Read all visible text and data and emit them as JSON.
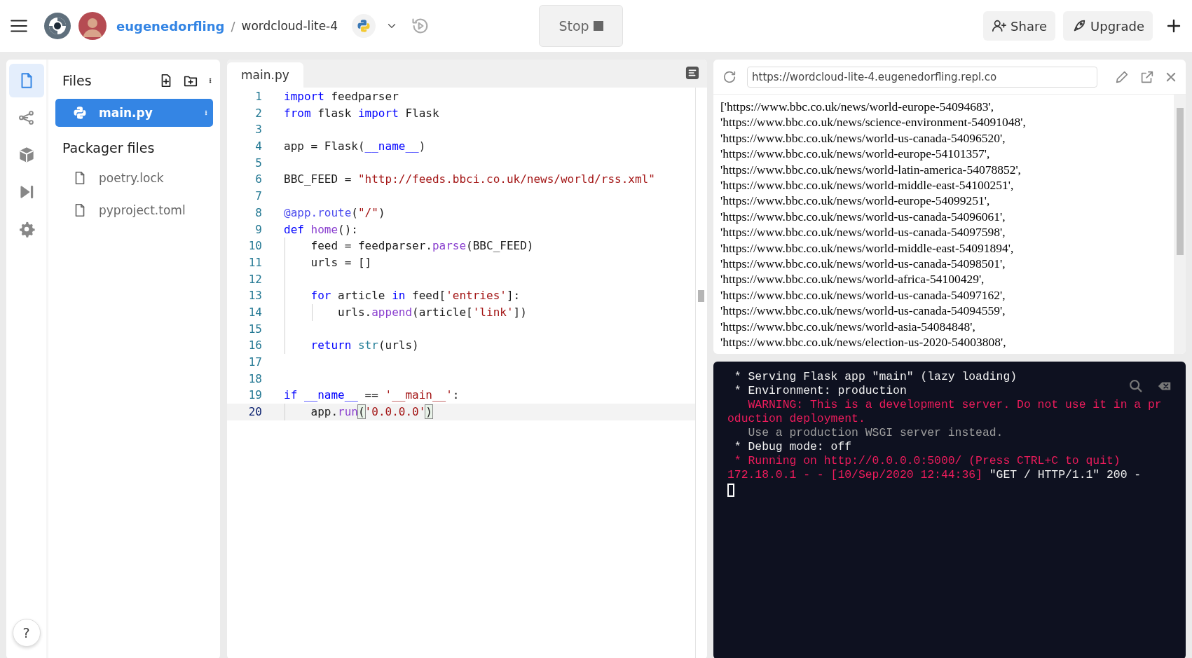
{
  "header": {
    "user": "eugenedorfling",
    "separator": "/",
    "repl_name": "wordcloud-lite-4",
    "stop_label": "Stop",
    "share_label": "Share",
    "upgrade_label": "Upgrade"
  },
  "sidebar_tools": [
    {
      "selected": true
    },
    {
      "selected": false
    },
    {
      "selected": false
    },
    {
      "selected": false
    },
    {
      "selected": false
    }
  ],
  "help_label": "?",
  "files_panel": {
    "title": "Files",
    "files": [
      {
        "name": "main.py",
        "selected": true
      }
    ],
    "packager_title": "Packager files",
    "packager_files": [
      {
        "name": "poetry.lock",
        "selected": false
      },
      {
        "name": "pyproject.toml",
        "selected": false
      }
    ]
  },
  "editor": {
    "tabs": [
      {
        "label": "main.py",
        "selected": true
      }
    ],
    "lines": [
      {
        "number": "1",
        "current": false,
        "tokens": [
          {
            "text": "import",
            "kind": "keyword"
          },
          {
            "text": " feedparser",
            "kind": "plain"
          }
        ]
      },
      {
        "number": "2",
        "current": false,
        "tokens": [
          {
            "text": "from",
            "kind": "keyword"
          },
          {
            "text": " flask ",
            "kind": "plain"
          },
          {
            "text": "import",
            "kind": "keyword"
          },
          {
            "text": " Flask",
            "kind": "plain"
          }
        ]
      },
      {
        "number": "3",
        "current": false
      },
      {
        "number": "4",
        "current": false,
        "tokens": [
          {
            "text": "app = Flask(",
            "kind": "plain"
          },
          {
            "text": "__name__",
            "kind": "keyword"
          },
          {
            "text": ")",
            "kind": "plain"
          }
        ]
      },
      {
        "number": "5",
        "current": false
      },
      {
        "number": "6",
        "current": false,
        "tokens": [
          {
            "text": "BBC_FEED = ",
            "kind": "plain"
          },
          {
            "text": "\"http://feeds.bbci.co.uk/news/world/rss.xml\"",
            "kind": "string"
          }
        ]
      },
      {
        "number": "7",
        "current": false
      },
      {
        "number": "8",
        "current": false,
        "tokens": [
          {
            "text": "@app.route",
            "kind": "decorator"
          },
          {
            "text": "(",
            "kind": "plain"
          },
          {
            "text": "\"/\"",
            "kind": "string"
          },
          {
            "text": ")",
            "kind": "plain"
          }
        ]
      },
      {
        "number": "9",
        "current": false,
        "tokens": [
          {
            "text": "def ",
            "kind": "keyword"
          },
          {
            "text": "home",
            "kind": "function"
          },
          {
            "text": "():",
            "kind": "plain"
          }
        ]
      },
      {
        "number": "10",
        "current": false,
        "tokens": [
          {
            "text": "    feed = feedparser.",
            "kind": "plain"
          },
          {
            "text": "parse",
            "kind": "function"
          },
          {
            "text": "(BBC_FEED)",
            "kind": "plain"
          }
        ]
      },
      {
        "number": "11",
        "current": false,
        "tokens": [
          {
            "text": "    urls = []",
            "kind": "plain"
          }
        ]
      },
      {
        "number": "12",
        "current": false
      },
      {
        "number": "13",
        "current": false,
        "tokens": [
          {
            "text": "    for",
            "kind": "keyword"
          },
          {
            "text": " article ",
            "kind": "plain"
          },
          {
            "text": "in",
            "kind": "keyword"
          },
          {
            "text": " feed[",
            "kind": "plain"
          },
          {
            "text": "'entries'",
            "kind": "string"
          },
          {
            "text": "]:",
            "kind": "plain"
          }
        ]
      },
      {
        "number": "14",
        "current": false,
        "tokens": [
          {
            "text": "        urls.",
            "kind": "plain"
          },
          {
            "text": "append",
            "kind": "function"
          },
          {
            "text": "(article[",
            "kind": "plain"
          },
          {
            "text": "'link'",
            "kind": "string"
          },
          {
            "text": "])",
            "kind": "plain"
          }
        ]
      },
      {
        "number": "15",
        "current": false
      },
      {
        "number": "16",
        "current": false,
        "tokens": [
          {
            "text": "    return ",
            "kind": "keyword"
          },
          {
            "text": "str",
            "kind": "builtin"
          },
          {
            "text": "(urls)",
            "kind": "plain"
          }
        ]
      },
      {
        "number": "17",
        "current": false
      },
      {
        "number": "18",
        "current": false
      },
      {
        "number": "19",
        "current": false,
        "tokens": [
          {
            "text": "if __name__",
            "kind": "keyword"
          },
          {
            "text": " == ",
            "kind": "plain"
          },
          {
            "text": "'__main__'",
            "kind": "string"
          },
          {
            "text": ":",
            "kind": "plain"
          }
        ]
      },
      {
        "number": "20",
        "current": true,
        "tokens": [
          {
            "text": "    app.",
            "kind": "plain"
          },
          {
            "text": "run",
            "kind": "function"
          },
          {
            "text": "(",
            "kind": "match"
          },
          {
            "text": "'0.0.0.0'",
            "kind": "string"
          },
          {
            "text": ")",
            "kind": "match"
          }
        ]
      }
    ]
  },
  "webview": {
    "url": "https://wordcloud-lite-4.eugenedorfling.repl.co",
    "output_lines": [
      "['https://www.bbc.co.uk/news/world-europe-54094683',",
      "'https://www.bbc.co.uk/news/science-environment-54091048',",
      "'https://www.bbc.co.uk/news/world-us-canada-54096520',",
      "'https://www.bbc.co.uk/news/world-europe-54101357',",
      "'https://www.bbc.co.uk/news/world-latin-america-54078852',",
      "'https://www.bbc.co.uk/news/world-middle-east-54100251',",
      "'https://www.bbc.co.uk/news/world-europe-54099251',",
      "'https://www.bbc.co.uk/news/world-us-canada-54096061',",
      "'https://www.bbc.co.uk/news/world-us-canada-54097598',",
      "'https://www.bbc.co.uk/news/world-middle-east-54091894',",
      "'https://www.bbc.co.uk/news/world-us-canada-54098501',",
      "'https://www.bbc.co.uk/news/world-africa-54100429',",
      "'https://www.bbc.co.uk/news/world-us-canada-54097162',",
      "'https://www.bbc.co.uk/news/world-us-canada-54094559',",
      "'https://www.bbc.co.uk/news/world-asia-54084848',",
      "'https://www.bbc.co.uk/news/election-us-2020-54003808',"
    ]
  },
  "console": {
    "lines": [
      {
        "segments": [
          {
            "text": " * Serving Flask app \"main\" (lazy loading)",
            "color": "#f0f0f0"
          }
        ]
      },
      {
        "segments": [
          {
            "text": " * Environment: production",
            "color": "#f0f0f0"
          }
        ]
      },
      {
        "segments": [
          {
            "text": "   WARNING: This is a development server. Do not use it in a pr",
            "color": "#ee1c5c"
          }
        ]
      },
      {
        "segments": [
          {
            "text": "oduction deployment.",
            "color": "#ee1c5c"
          }
        ]
      },
      {
        "segments": [
          {
            "text": "   Use a production WSGI server instead.",
            "color": "#9c9c9c"
          }
        ]
      },
      {
        "segments": [
          {
            "text": " * Debug mode: off",
            "color": "#f0f0f0"
          }
        ]
      },
      {
        "segments": [
          {
            "text": " * Running on http://0.0.0.0:5000/ (Press CTRL+C to quit)",
            "color": "#ee1c5c"
          }
        ]
      },
      {
        "segments": [
          {
            "text": "172.18.0.1 - - [10/Sep/2020 12:44:36] ",
            "color": "#ee1c5c"
          },
          {
            "text": "\"GET / HTTP/1.1\" 200 -",
            "color": "#f0f0f0"
          }
        ]
      }
    ]
  }
}
